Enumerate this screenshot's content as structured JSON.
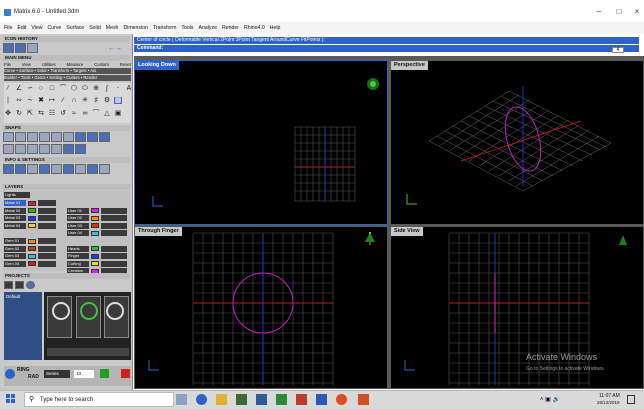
{
  "window": {
    "title": "Matrix 6.0 - Untitled 3dm"
  },
  "menu": [
    "File",
    "Edit",
    "View",
    "Curve",
    "Surface",
    "Solid",
    "Mesh",
    "Dimension",
    "Transform",
    "Tools",
    "Analyze",
    "Render",
    "Rhino4.0",
    "Help"
  ],
  "left_panel": {
    "icon_history": "ICON HISTORY",
    "main_menu": "MAIN MENU",
    "tabs": [
      "File",
      "View",
      "Utilities",
      "Measure",
      "Custom",
      "Reset"
    ],
    "categories_row1": "Curve • Surface • Solid • Transform • Targets • Ani",
    "categories_row2": "Builder • Tools • Gems • Setting • Cutters • Render",
    "snaps": "SNAPS",
    "info_settings": "INFO & SETTINGS",
    "layers": "LAYERS",
    "layers_header": "Lights",
    "layers_left": [
      "Metal 01",
      "Metal 02",
      "Metal 03",
      "Metal 04",
      "",
      "Gem 01",
      "Gem 02",
      "Gem 03",
      "Gem 04"
    ],
    "layers_right": [
      "",
      "User 01",
      "User 02",
      "User 03",
      "User 04",
      "",
      "Heads",
      "Finger",
      "Cutting",
      "Creation"
    ],
    "layer_colors": [
      "#e02020",
      "#20c020",
      "#2040e0",
      "#e0e020",
      "#e020e0",
      "#ff8800",
      "#c04000",
      "#40c0c0"
    ],
    "projects": "PROJECTS",
    "default_label": "Default",
    "ring": "RING",
    "rad": "RAD",
    "series": "Series",
    "series_value": "13"
  },
  "command": {
    "line1": "Center of circle ( Deformable  Vertical  2Point  3Point  Tangent  AroundCurve  FitPoints ):",
    "line2": "Command:",
    "page_indicator": "4"
  },
  "viewports": [
    {
      "label": "Looking Down",
      "active": true
    },
    {
      "label": "Perspective",
      "active": false
    },
    {
      "label": "Through Finger",
      "active": false
    },
    {
      "label": "Side View",
      "active": false
    }
  ],
  "watermark": {
    "line1": "Activate Windows",
    "line2": "Go to Settings to activate Windows."
  },
  "taskbar": {
    "search_placeholder": "Type here to search",
    "time": "11:07 AM",
    "date": "26/12/2019"
  },
  "colors": {
    "accent": "#2d62c9",
    "grid": "#555555",
    "circle": "#d020d0",
    "axis_x": "#d02020",
    "axis_y": "#2040e0"
  }
}
